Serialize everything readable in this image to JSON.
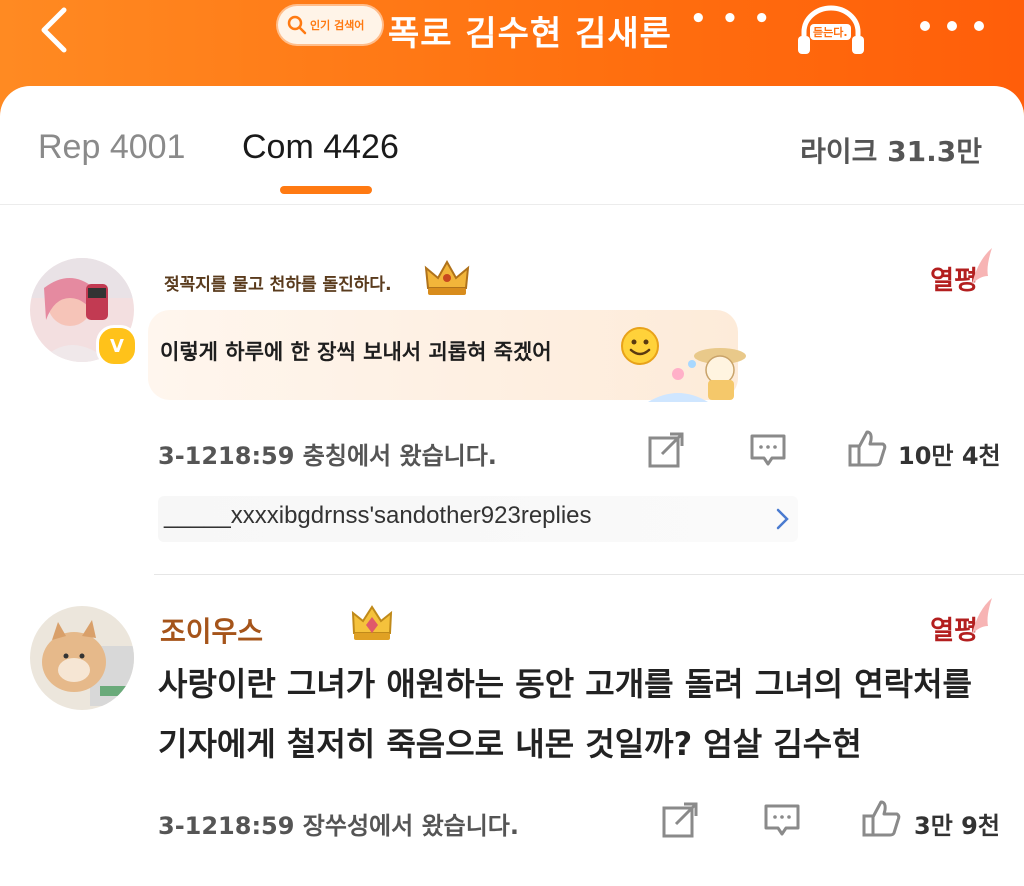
{
  "header": {
    "back_icon": "chevron-left-icon",
    "search_pill_label": "인기 검색어",
    "topic_title": "폭로 김수현 김새론",
    "topic_more": "• • •",
    "listen_label": "듣는다.",
    "more_icon": "more-dots-icon",
    "accent_color": "#ff7a12"
  },
  "tabs": {
    "rep_label": "Rep 4001",
    "com_label": "Com 4426",
    "like_label": "라이크 31.3만",
    "active": "Com 4426"
  },
  "comments": [
    {
      "username": "젖꼭지를 물고 천하를 돌진하다.",
      "badge": "열평",
      "text": "이렇게 하루에 한 장씩 보내서 괴롭혀 죽겠어",
      "meta": "3-1218:59 충칭에서 왔습니다.",
      "likes": "10만 4천",
      "replies": "_____xxxxibgdrnss'sandother923replies",
      "verified_mark": "V"
    },
    {
      "username": "조이우스",
      "badge": "열평",
      "text_line1": "사랑이란 그녀가 애원하는 동안 고개를 돌려 그녀의 연락처를",
      "text_line2": "기자에게 철저히 죽음으로 내몬 것일까? 엄살 김수현",
      "meta": "3-1218:59 장쑤성에서 왔습니다.",
      "likes": "3만 9천"
    }
  ]
}
